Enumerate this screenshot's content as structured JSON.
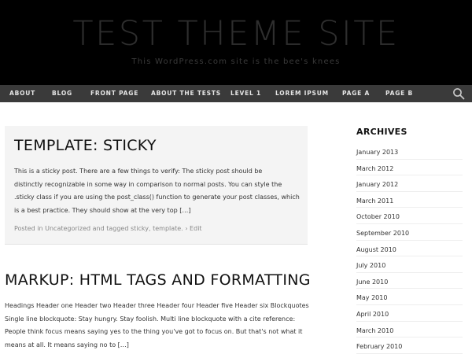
{
  "header": {
    "site_title": "TEST THEME SITE",
    "site_description": "This WordPress.com site is the bee's knees"
  },
  "nav": {
    "items": [
      "ABOUT",
      "BLOG",
      "FRONT PAGE",
      "ABOUT THE TESTS",
      "LEVEL 1",
      "LOREM IPSUM",
      "PAGE A",
      "PAGE B"
    ],
    "search_icon": "search-icon"
  },
  "posts": [
    {
      "title": "TEMPLATE: STICKY",
      "excerpt_lines": [
        "This is a sticky post. There are a few things to verify: The sticky post should be",
        "distinctly recognizable in some way in comparison to normal posts. You can style the",
        ".sticky class if you are using the post_class() function to generate your post classes, which",
        "is a best practice. They should show at the very top […]"
      ],
      "meta": {
        "posted_in": "Posted in",
        "category": "Uncategorized",
        "and_tagged": "and tagged",
        "tag1": "sticky",
        "comma": ",",
        "tag2": "template",
        "period": ".",
        "edit": "› Edit"
      }
    },
    {
      "title": "MARKUP: HTML TAGS AND FORMATTING",
      "excerpt_lines": [
        "Headings Header one Header two Header three Header four Header five Header six Blockquotes",
        "Single line blockquote: Stay hungry. Stay foolish. Multi line blockquote with a cite reference:",
        "People think focus means saying yes to the thing you've got to focus on. But that's not what it",
        "means at all. It means saying no to […]"
      ]
    }
  ],
  "sidebar": {
    "title": "ARCHIVES",
    "archives": [
      "January 2013",
      "March 2012",
      "January 2012",
      "March 2011",
      "October 2010",
      "September 2010",
      "August 2010",
      "July 2010",
      "June 2010",
      "May 2010",
      "April 2010",
      "March 2010",
      "February 2010"
    ]
  }
}
